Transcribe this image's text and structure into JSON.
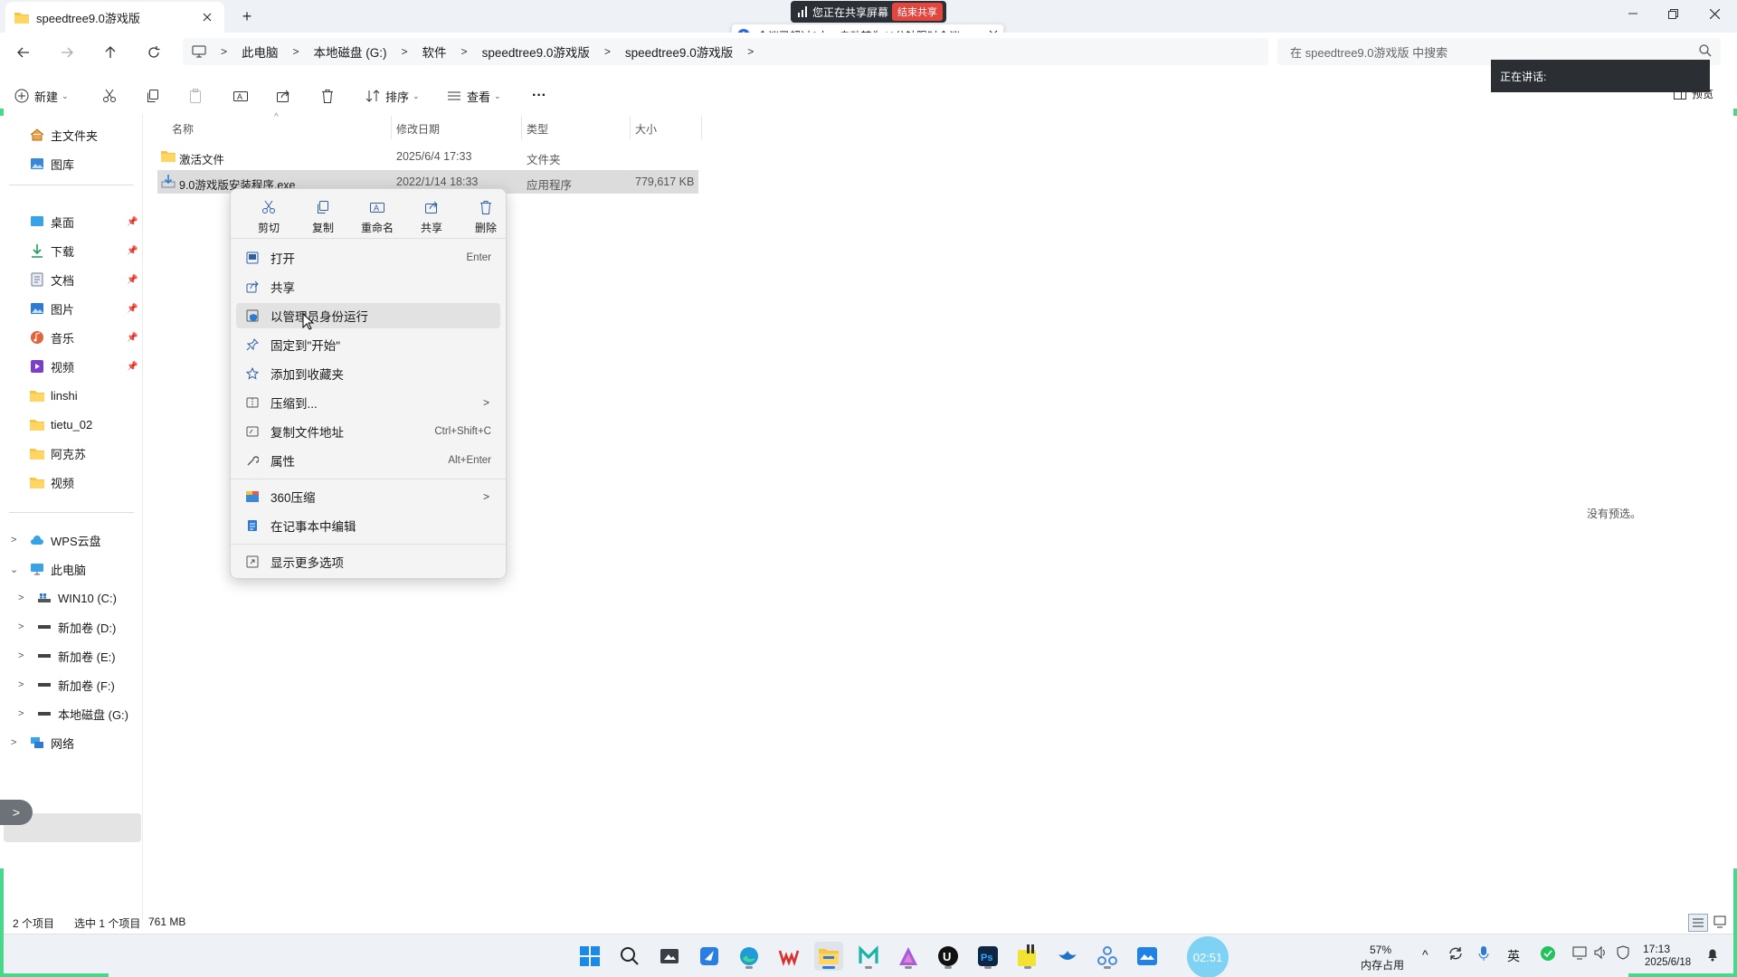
{
  "tab": {
    "title": "speedtree9.0游戏版",
    "new_tab": "+"
  },
  "share_banner": {
    "text": "您正在共享屏幕",
    "end_label": "结束共享"
  },
  "meeting_toast": {
    "text": "会议已超过2人，自动转为40分钟限时会议。"
  },
  "breadcrumb": [
    "此电脑",
    "本地磁盘 (G:)",
    "软件",
    "speedtree9.0游戏版",
    "speedtree9.0游戏版"
  ],
  "search": {
    "placeholder": "在 speedtree9.0游戏版 中搜索"
  },
  "speaking": {
    "label": "正在讲话:"
  },
  "toolbar": {
    "new_label": "新建",
    "sort_label": "排序",
    "view_label": "查看",
    "more_label": "···",
    "preview_label": "预览"
  },
  "sidebar": {
    "home": "主文件夹",
    "gallery": "图库",
    "pinned": [
      "桌面",
      "下载",
      "文档",
      "图片",
      "音乐",
      "视频"
    ],
    "folders": [
      "linshi",
      "tietu_02",
      "阿克苏",
      "视频"
    ],
    "wps": "WPS云盘",
    "this_pc": "此电脑",
    "drives": [
      "WIN10 (C:)",
      "新加卷 (D:)",
      "新加卷 (E:)",
      "新加卷 (F:)",
      "本地磁盘 (G:)"
    ],
    "network": "网络"
  },
  "columns": {
    "name": "名称",
    "modified": "修改日期",
    "type": "类型",
    "size": "大小"
  },
  "files": [
    {
      "name": "激活文件",
      "modified": "2025/6/4 17:33",
      "type": "文件夹",
      "size": ""
    },
    {
      "name": "9.0游戏版安装程序.exe",
      "modified": "2022/1/14 18:33",
      "type": "应用程序",
      "size": "779,617 KB"
    }
  ],
  "context_menu": {
    "quick": [
      "剪切",
      "复制",
      "重命名",
      "共享",
      "删除"
    ],
    "items": [
      {
        "label": "打开",
        "shortcut": "Enter"
      },
      {
        "label": "共享",
        "shortcut": ""
      },
      {
        "label": "以管理员身份运行",
        "shortcut": ""
      },
      {
        "label": "固定到\"开始\"",
        "shortcut": ""
      },
      {
        "label": "添加到收藏夹",
        "shortcut": ""
      },
      {
        "label": "压缩到...",
        "shortcut": ""
      },
      {
        "label": "复制文件地址",
        "shortcut": "Ctrl+Shift+C"
      },
      {
        "label": "属性",
        "shortcut": "Alt+Enter"
      },
      {
        "label": "360压缩",
        "shortcut": ""
      },
      {
        "label": "在记事本中编辑",
        "shortcut": ""
      },
      {
        "label": "显示更多选项",
        "shortcut": ""
      }
    ]
  },
  "preview_pane": {
    "text": "没有预选。"
  },
  "status": {
    "count": "2 个项目",
    "selected": "选中 1 个项目",
    "size": "761 MB"
  },
  "taskbar": {
    "timer": "02:51",
    "memory_percent": "57%",
    "memory_label": "内存占用",
    "ime": "英",
    "time": "17:13",
    "date": "2025/6/18"
  }
}
